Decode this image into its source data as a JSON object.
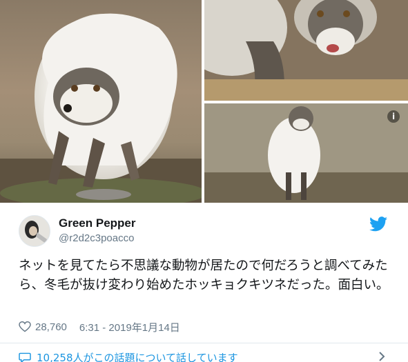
{
  "tweet": {
    "display_name": "Green Pepper",
    "handle": "@r2d2c3poacco",
    "text": "ネットを見てたら不思議な動物が居たので何だろうと調べてみたら、冬毛が抜け変わり始めたホッキョクキツネだった。面白い。",
    "likes": "28,760",
    "timestamp": "6:31 - 2019年1月14日",
    "conversation": "10,258人がこの話題について話しています"
  },
  "icons": {
    "info": "info-icon",
    "twitter": "twitter-bird-icon",
    "like": "heart-icon",
    "reply": "speech-bubble-icon",
    "expand": "chevron-right-icon"
  },
  "colors": {
    "text": "#14171a",
    "muted": "#657786",
    "link": "#1b95e0",
    "twitter_blue": "#1da1f2"
  }
}
